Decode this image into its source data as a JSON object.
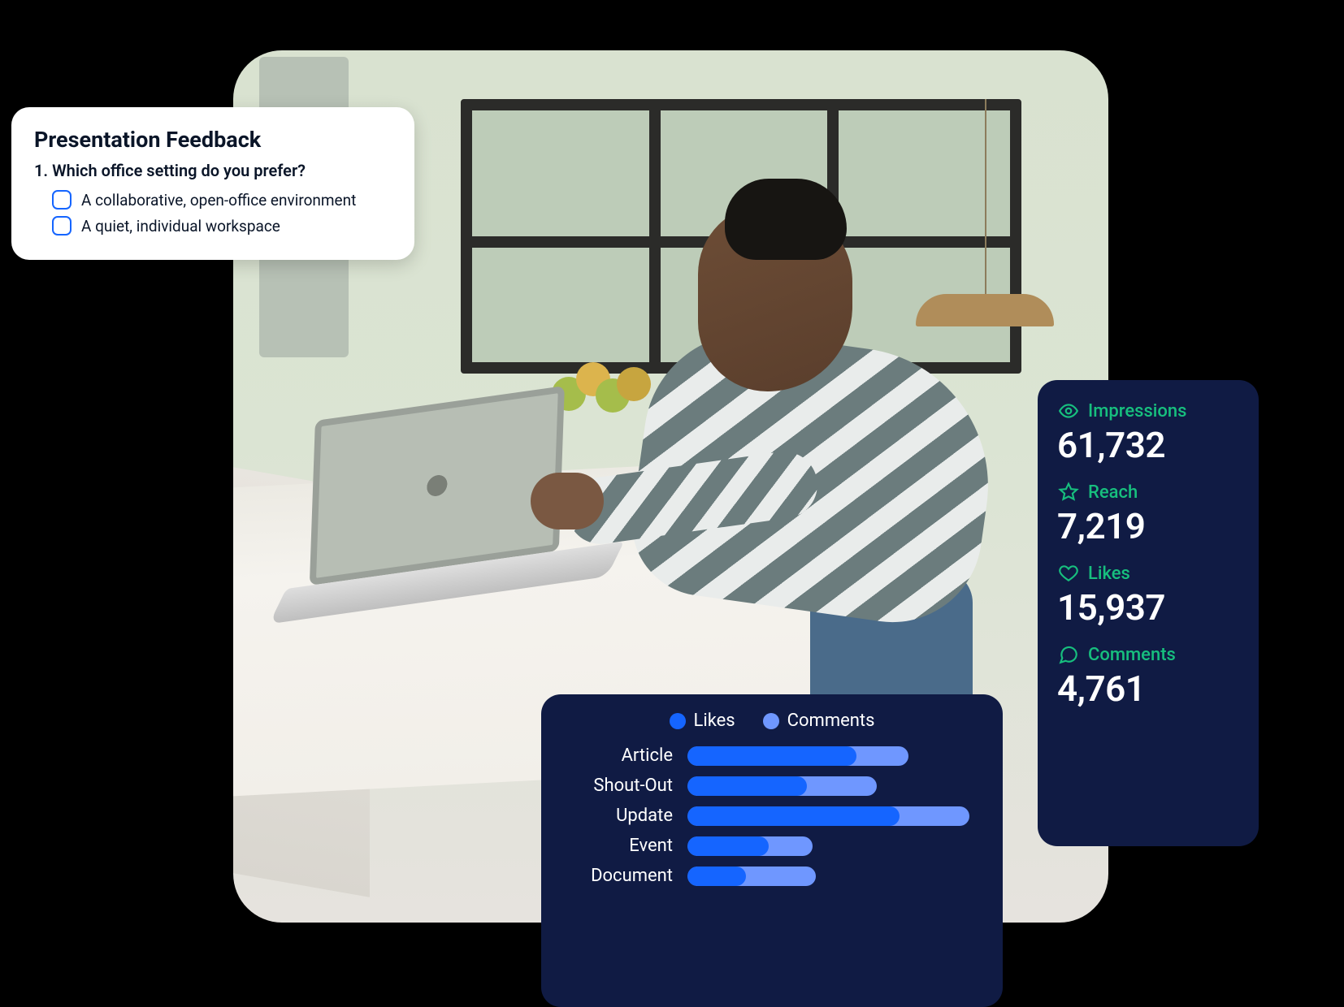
{
  "feedback": {
    "title": "Presentation Feedback",
    "question_number": "1.",
    "question_text": "Which office setting do you prefer?",
    "options": [
      "A collaborative, open-office environment",
      "A quiet, individual workspace"
    ]
  },
  "stats": [
    {
      "icon": "eye",
      "label": "Impressions",
      "value": "61,732"
    },
    {
      "icon": "star",
      "label": "Reach",
      "value": "7,219"
    },
    {
      "icon": "heart",
      "label": "Likes",
      "value": "15,937"
    },
    {
      "icon": "comment",
      "label": "Comments",
      "value": "4,761"
    }
  ],
  "chart_data": {
    "type": "bar",
    "orientation": "horizontal",
    "stacked": true,
    "legend": [
      {
        "name": "Likes",
        "color": "#1565ff"
      },
      {
        "name": "Comments",
        "color": "#6f97ff"
      }
    ],
    "categories": [
      "Article",
      "Shout-Out",
      "Update",
      "Event",
      "Document"
    ],
    "series": [
      {
        "name": "Likes",
        "values": [
          58,
          41,
          73,
          28,
          20
        ]
      },
      {
        "name": "Comments",
        "values": [
          18,
          24,
          24,
          15,
          24
        ]
      }
    ],
    "xlim": [
      0,
      100
    ],
    "value_unit": "percent_of_max_bar_width"
  },
  "colors": {
    "card_bg_dark": "#101b44",
    "accent_green": "#17bf7e",
    "brand_blue": "#1565ff",
    "brand_blue_light": "#6f97ff"
  }
}
